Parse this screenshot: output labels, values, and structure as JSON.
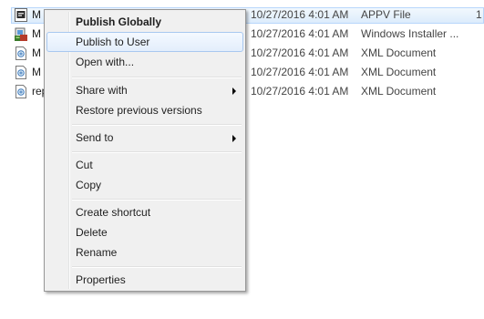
{
  "files": [
    {
      "name": "M",
      "date": "10/27/2016 4:01 AM",
      "type": "APPV File",
      "size": "1",
      "icon": "appv-file-icon",
      "selected": true
    },
    {
      "name": "M",
      "date": "10/27/2016 4:01 AM",
      "type": "Windows Installer ...",
      "size": "",
      "icon": "installer-file-icon",
      "selected": false
    },
    {
      "name": "M",
      "date": "10/27/2016 4:01 AM",
      "type": "XML Document",
      "size": "",
      "icon": "xml-file-icon",
      "selected": false
    },
    {
      "name": "M",
      "date": "10/27/2016 4:01 AM",
      "type": "XML Document",
      "size": "",
      "icon": "xml-file-icon",
      "selected": false
    },
    {
      "name": "rep",
      "date": "10/27/2016 4:01 AM",
      "type": "XML Document",
      "size": "",
      "icon": "xml-file-icon",
      "selected": false
    }
  ],
  "context_menu": {
    "publish_globally": "Publish Globally",
    "publish_to_user": "Publish to User",
    "open_with": "Open with...",
    "share_with": "Share with",
    "restore_previous_versions": "Restore previous versions",
    "send_to": "Send to",
    "cut": "Cut",
    "copy": "Copy",
    "create_shortcut": "Create shortcut",
    "delete": "Delete",
    "rename": "Rename",
    "properties": "Properties"
  },
  "colors": {
    "selection_border": "#b8d6fb",
    "hover_border": "#a8c8f0",
    "menu_background": "#f0f0f0"
  }
}
